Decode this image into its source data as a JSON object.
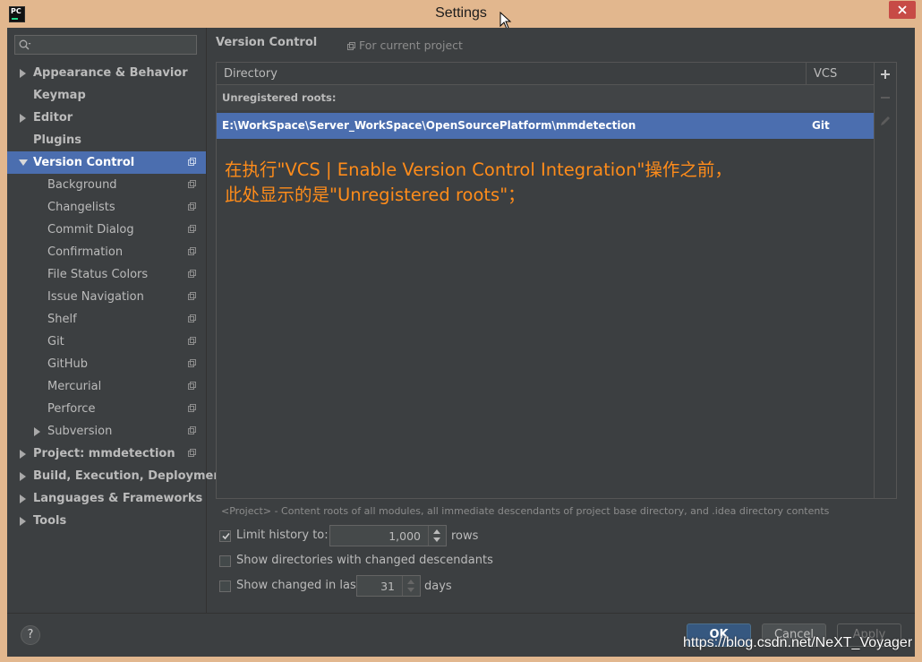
{
  "window": {
    "title": "Settings",
    "app_icon_text": "PC"
  },
  "sidebar": {
    "search_placeholder": "",
    "items": [
      {
        "label": "Appearance & Behavior",
        "level": 0,
        "arrow": "right",
        "bold": true
      },
      {
        "label": "Keymap",
        "level": 0,
        "arrow": "",
        "bold": true
      },
      {
        "label": "Editor",
        "level": 0,
        "arrow": "right",
        "bold": true
      },
      {
        "label": "Plugins",
        "level": 0,
        "arrow": "",
        "bold": true
      },
      {
        "label": "Version Control",
        "level": 0,
        "arrow": "down",
        "bold": true,
        "selected": true,
        "project_icon": true
      },
      {
        "label": "Background",
        "level": 1,
        "arrow": "",
        "project_icon": true
      },
      {
        "label": "Changelists",
        "level": 1,
        "arrow": "",
        "project_icon": true
      },
      {
        "label": "Commit Dialog",
        "level": 1,
        "arrow": "",
        "project_icon": true
      },
      {
        "label": "Confirmation",
        "level": 1,
        "arrow": "",
        "project_icon": true
      },
      {
        "label": "File Status Colors",
        "level": 1,
        "arrow": "",
        "project_icon": true
      },
      {
        "label": "Issue Navigation",
        "level": 1,
        "arrow": "",
        "project_icon": true
      },
      {
        "label": "Shelf",
        "level": 1,
        "arrow": "",
        "project_icon": true
      },
      {
        "label": "Git",
        "level": 1,
        "arrow": "",
        "project_icon": true
      },
      {
        "label": "GitHub",
        "level": 1,
        "arrow": "",
        "project_icon": true
      },
      {
        "label": "Mercurial",
        "level": 1,
        "arrow": "",
        "project_icon": true
      },
      {
        "label": "Perforce",
        "level": 1,
        "arrow": "",
        "project_icon": true
      },
      {
        "label": "Subversion",
        "level": 1,
        "arrow": "right",
        "project_icon": true
      },
      {
        "label": "Project: mmdetection",
        "level": 0,
        "arrow": "right",
        "bold": true,
        "project_icon": true
      },
      {
        "label": "Build, Execution, Deployment",
        "level": 0,
        "arrow": "right",
        "bold": true
      },
      {
        "label": "Languages & Frameworks",
        "level": 0,
        "arrow": "right",
        "bold": true
      },
      {
        "label": "Tools",
        "level": 0,
        "arrow": "right",
        "bold": true
      }
    ]
  },
  "main": {
    "title": "Version Control",
    "scope": "For current project",
    "table": {
      "headers": [
        "Directory",
        "VCS"
      ],
      "group_label": "Unregistered roots:",
      "rows": [
        {
          "directory": "E:\\WorkSpace\\Server_WorkSpace\\OpenSourcePlatform\\mmdetection",
          "vcs": "Git"
        }
      ]
    },
    "annotation_lines": [
      "在执行\"VCS | Enable Version Control Integration\"操作之前，",
      "此处显示的是\"Unregistered roots\"；"
    ],
    "hint": "<Project> - Content roots of all modules, all immediate descendants of project base directory, and .idea directory contents",
    "options": {
      "limit_history": {
        "label": "Limit history to:",
        "checked": true,
        "value": "1,000",
        "suffix": "rows"
      },
      "show_dirs": {
        "label": "Show directories with changed descendants",
        "checked": false
      },
      "show_changed": {
        "label": "Show changed in last",
        "checked": false,
        "value": "31",
        "suffix": "days"
      }
    }
  },
  "footer": {
    "help": "?",
    "ok": "OK",
    "cancel": "Cancel",
    "apply": "Apply"
  },
  "watermark": "https://blog.csdn.net/NeXT_Voyager",
  "colors": {
    "accent": "#4b6eaf",
    "annotation": "#ff8c1a",
    "background": "#3c3f41"
  }
}
